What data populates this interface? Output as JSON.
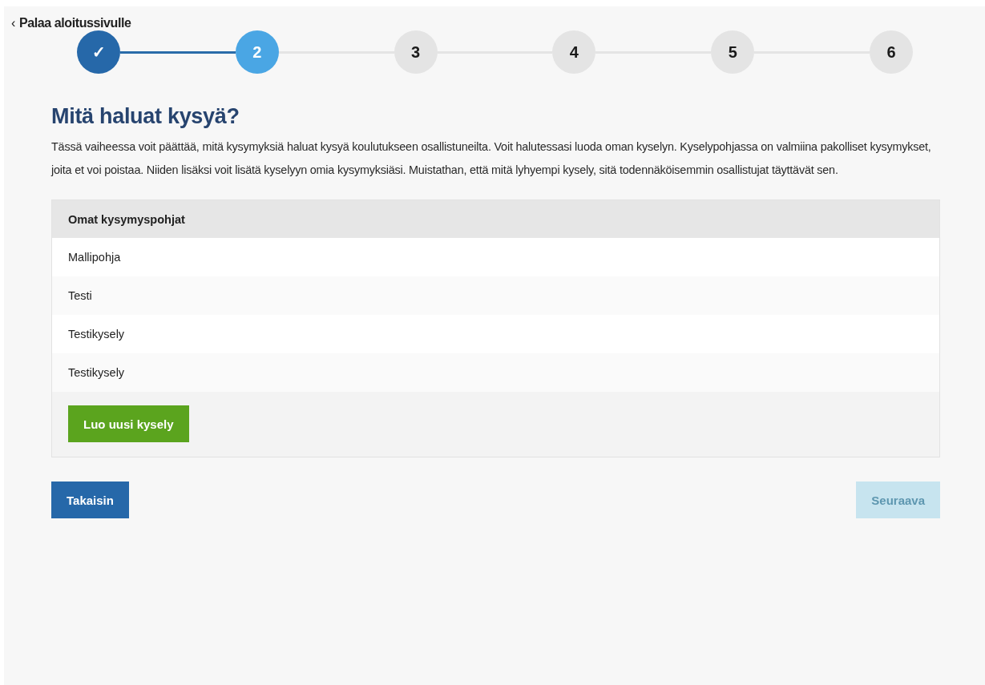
{
  "back_link": {
    "icon": "‹",
    "label": "Palaa aloitussivulle"
  },
  "steps": [
    {
      "label": "✓",
      "done": true,
      "selected": false
    },
    {
      "label": "2",
      "done": false,
      "selected": true
    },
    {
      "label": "3",
      "done": false,
      "selected": false
    },
    {
      "label": "4",
      "done": false,
      "selected": false
    },
    {
      "label": "5",
      "done": false,
      "selected": false
    },
    {
      "label": "6",
      "done": false,
      "selected": false
    }
  ],
  "heading": "Mitä haluat kysyä?",
  "intro": "Tässä vaiheessa voit päättää, mitä kysymyksiä haluat kysyä koulutukseen osallistuneilta. Voit halutessasi luoda oman kyselyn. Kyselypohjassa on valmiina pakolliset kysymykset, joita et voi poistaa. Niiden lisäksi voit lisätä kyselyyn omia kysymyksiäsi. Muistathan, että mitä lyhyempi kysely, sitä todennäköisemmin osallistujat täyttävät sen.",
  "templates": {
    "title": "Omat kysymyspohjat",
    "items": [
      "Mallipohja",
      "Testi",
      "Testikysely",
      "Testikysely"
    ],
    "create_button": "Luo uusi kysely"
  },
  "nav": [
    {
      "label": "Takaisin",
      "disabled": false
    },
    {
      "label": "Seuraava",
      "disabled": true
    }
  ]
}
